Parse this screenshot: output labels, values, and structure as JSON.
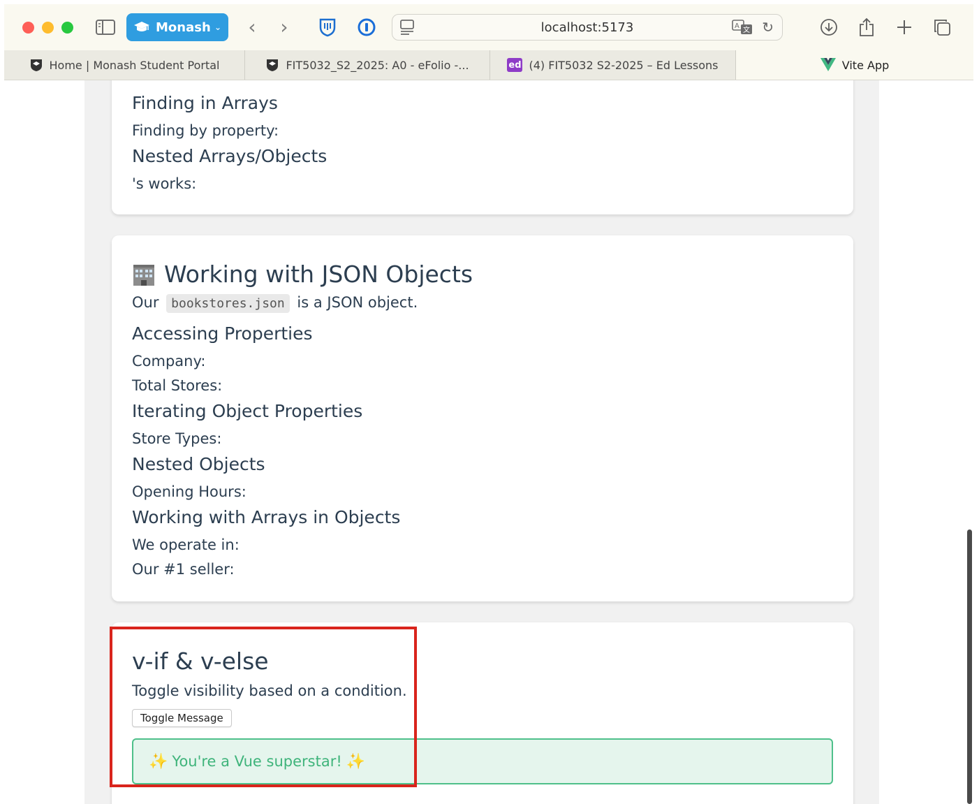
{
  "browser": {
    "profile_label": "Monash",
    "address": "localhost:5173",
    "tabs": [
      {
        "title": "Home | Monash Student Portal",
        "active": false
      },
      {
        "title": "FIT5032_S2_2025: A0 - eFolio -...",
        "active": false
      },
      {
        "title": "(4) FIT5032 S2-2025 – Ed Lessons",
        "active": false,
        "favicon_text": "ed"
      },
      {
        "title": "Vite App",
        "active": true
      }
    ]
  },
  "arrays_card": {
    "finding_heading": "Finding in Arrays",
    "finding_by_property": "Finding by property:",
    "nested_heading": "Nested Arrays/Objects",
    "works_text": "'s works:"
  },
  "json_card": {
    "title": "Working with JSON Objects",
    "intro_before": "Our",
    "intro_code": "bookstores.json",
    "intro_after": "is a JSON object.",
    "accessing_heading": "Accessing Properties",
    "company_label": "Company:",
    "total_stores_label": "Total Stores:",
    "iterating_heading": "Iterating Object Properties",
    "store_types_label": "Store Types:",
    "nested_objects_heading": "Nested Objects",
    "opening_hours_label": "Opening Hours:",
    "arrays_in_objects_heading": "Working with Arrays in Objects",
    "operate_in_label": "We operate in:",
    "top_seller_label": "Our #1 seller:"
  },
  "vif_card": {
    "title": "v-if & v-else",
    "description": "Toggle visibility based on a condition.",
    "button_label": "Toggle Message",
    "message": "You're a Vue superstar!",
    "sparkle": "✨"
  },
  "colors": {
    "highlight_box": "#d9241c",
    "alert_border": "#4ec08a",
    "alert_background": "#e5f5ed",
    "alert_text": "#3fb47b",
    "profile_button": "#2f9de0"
  }
}
